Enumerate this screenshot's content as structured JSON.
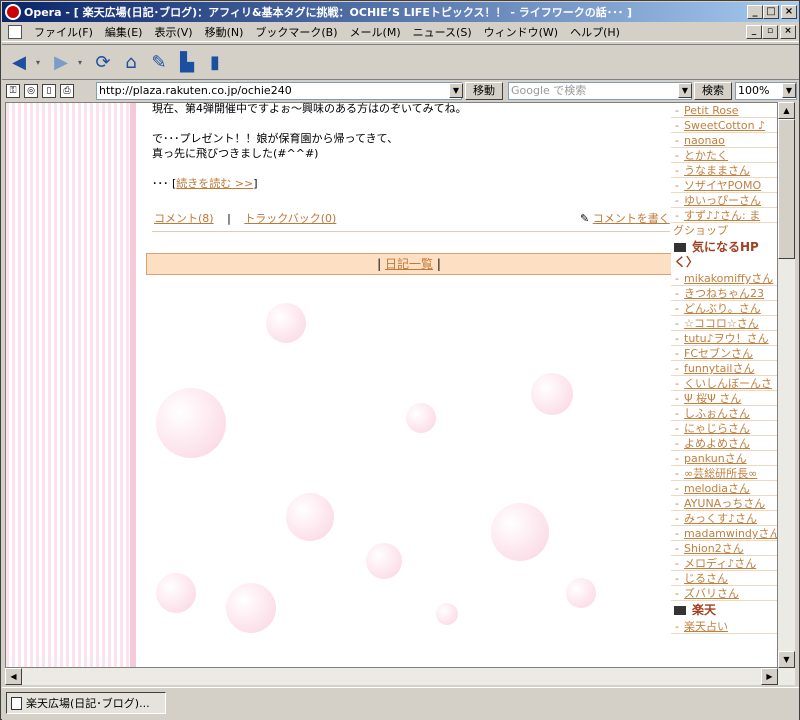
{
  "window": {
    "title": "Opera - [ 楽天広場(日記･ブログ)：アフィリ&基本タグに挑戦：OCHIE’S LIFEトピックス！！ - ライフワークの話･･･ ]",
    "minimize": "_",
    "maximize": "□",
    "close": "×"
  },
  "menubar": {
    "items": [
      "ファイル(F)",
      "編集(E)",
      "表示(V)",
      "移動(N)",
      "ブックマーク(B)",
      "メール(M)",
      "ニュース(S)",
      "ウィンドウ(W)",
      "ヘルプ(H)"
    ]
  },
  "address": {
    "url": "http://plaza.rakuten.co.jp/ochie240",
    "go_label": "移動",
    "search_placeholder": "Google で検索",
    "search_label": "検索",
    "zoom": "100%"
  },
  "entry": {
    "line1": "現在、第4弾開催中ですよぉ～興味のある方はのぞいてみてね。",
    "line2": "で･･･プレゼント！！娘が保育園から帰ってきて、",
    "line3": "真っ先に飛びつきました(#^^#)",
    "more_prefix": "･･･ [",
    "more_link": "続きを読む >>",
    "more_suffix": "]",
    "comment_link": "コメント(8)",
    "separator": "|",
    "trackback_link": "トラックバック(0)",
    "write_comment": "コメントを書く"
  },
  "nav": {
    "left_bar": "|",
    "diary_list": "日記一覧",
    "right_bar": "|"
  },
  "sidebar": {
    "top_items": [
      "Petit Rose",
      "SweetCotton ♪",
      "naonao",
      "とかたく",
      "うなままさん",
      "ソザイヤPOMO",
      "ゆいっぴーさん",
      "すず♪♪さん: ま"
    ],
    "partial_text": "グショップ",
    "header_hp": "気になるHP",
    "header_hp2": "く〉",
    "hp_items": [
      "mikakomiffyさん",
      "きつねちゃん23",
      "どんぶり。さん",
      "☆ココロ☆さん",
      "tutu♪ヲウ！さん",
      "FCセブンさん",
      "funnytailさん",
      "くいしんぼーんさ",
      "Ψ 桜Ψ さん",
      "しふぉんさん",
      "にゃじらさん",
      "よめよめさん",
      "pankunさん",
      "∞芸総研所長∞",
      "melodiaさん",
      "AYUNAっちさん",
      "みっくす♪さん",
      "madamwindyさん",
      "Shion2さん",
      "メロディ♪さん",
      "じるさん",
      "ズバリさん"
    ],
    "header_rakuten": "楽天",
    "rakuten_items": [
      "楽天占い"
    ]
  },
  "taskbar": {
    "task_label": "楽天広場(日記･ブログ)..."
  }
}
